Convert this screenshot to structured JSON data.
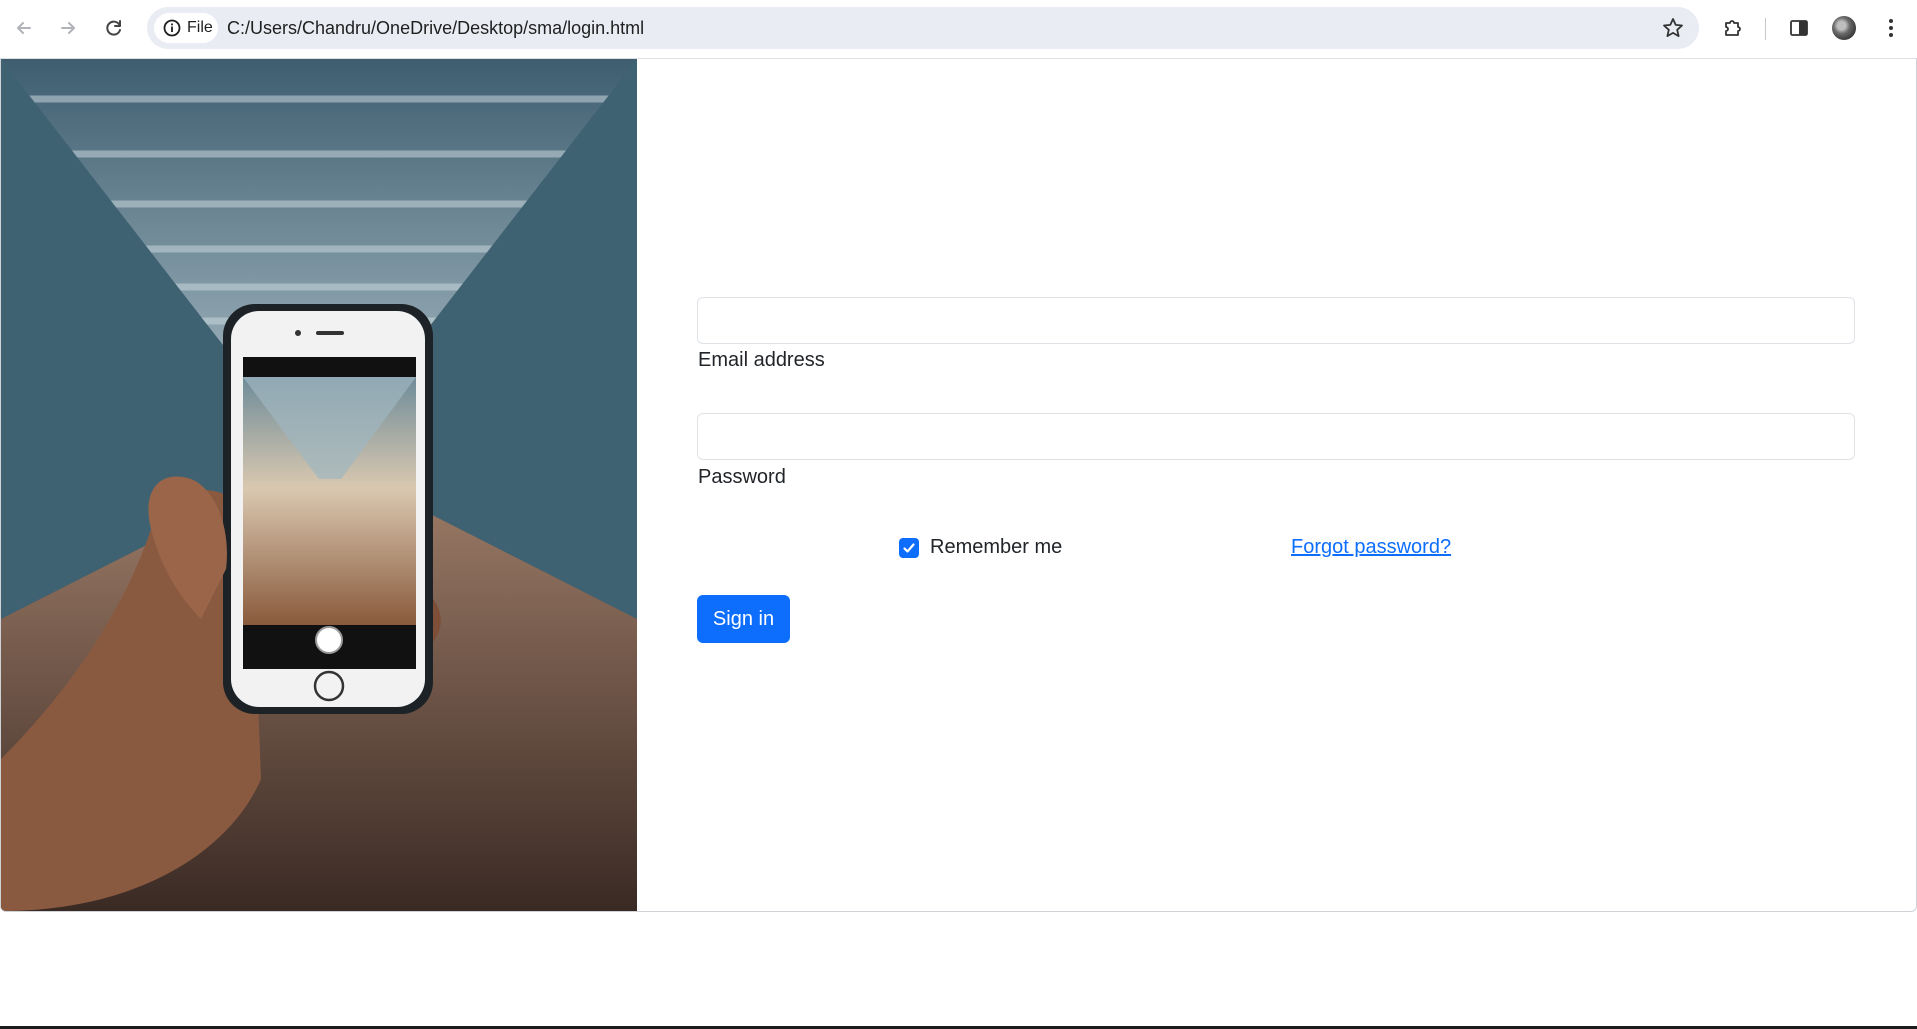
{
  "browser": {
    "address": {
      "chip_label": "File",
      "url": "C:/Users/Chandru/OneDrive/Desktop/sma/login.html"
    }
  },
  "hero_image": {
    "description_icon": "phone-in-hand-photo"
  },
  "form": {
    "email_label": "Email address",
    "email_value": "",
    "password_label": "Password",
    "password_value": "",
    "remember_label": "Remember me",
    "remember_checked": true,
    "forgot_link": "Forgot password?",
    "submit_label": "Sign in"
  },
  "colors": {
    "primary": "#0d6efd",
    "border": "#dee2e6"
  }
}
